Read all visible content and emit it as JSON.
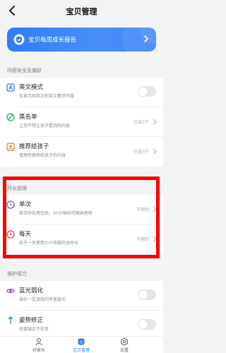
{
  "header": {
    "title": "宝贝管理",
    "back_icon": "chevron-left-icon"
  },
  "banner": {
    "text": "宝贝每周成长报告",
    "icon": "shield-heart-icon"
  },
  "sections": {
    "content": {
      "label": "内容安全及偏好",
      "items": [
        {
          "title": "英文模式",
          "subtitle": "仅显示纯英文和英文教学内容",
          "control": "toggle",
          "icon": "letter-a-icon"
        },
        {
          "title": "黑名单",
          "subtitle": "让您不想让孩子看到的内容",
          "value": "已选0个",
          "icon": "ban-icon"
        },
        {
          "title": "推荐给孩子",
          "subtitle": "管理你推荐给孩子的内容",
          "value": "已选0个",
          "icon": "recommend-icon"
        }
      ]
    },
    "time": {
      "label": "时长管理",
      "items": [
        {
          "title": "单次",
          "subtitle": "单次时长用完后，30分钟后可继续使用",
          "value": "不限制",
          "icon": "clock-rotate-icon"
        },
        {
          "title": "每天",
          "subtitle": "孩子一天使用小小优酷的总时长",
          "value": "不限制",
          "icon": "clock-day-icon"
        }
      ]
    },
    "eye": {
      "label": "保护视力",
      "items": [
        {
          "title": "蓝光弱化",
          "subtitle": "弱化一定波段的有害蓝光",
          "control": "toggle",
          "icon": "eye-icon"
        },
        {
          "title": "姿势矫正",
          "subtitle": "坐姿端正不驼背",
          "control": "toggle",
          "icon": "posture-icon"
        }
      ]
    }
  },
  "tabbar": {
    "tabs": [
      {
        "label": "好家长",
        "icon": "parent-icon"
      },
      {
        "label": "宝贝管理",
        "icon": "baby-icon",
        "active": true
      },
      {
        "label": "设置",
        "icon": "settings-icon"
      }
    ]
  },
  "colors": {
    "accent": "#2f7cf6",
    "highlight": "#ff0000",
    "background": "#f2f3f5"
  }
}
